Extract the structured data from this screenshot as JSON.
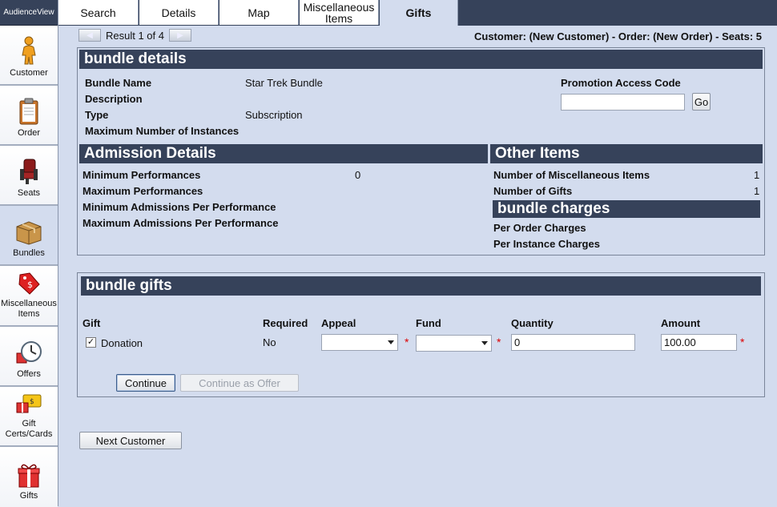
{
  "brand": "AudienceView",
  "nav": [
    {
      "label": "Customer",
      "icon": "customer-icon"
    },
    {
      "label": "Order",
      "icon": "clipboard-icon"
    },
    {
      "label": "Seats",
      "icon": "seat-icon"
    },
    {
      "label": "Bundles",
      "icon": "bundle-box-icon"
    },
    {
      "label": "Miscellaneous Items",
      "icon": "price-tag-icon"
    },
    {
      "label": "Offers",
      "icon": "clock-icon"
    },
    {
      "label": "Gift Certs/Cards",
      "icon": "gift-card-icon"
    },
    {
      "label": "Gifts",
      "icon": "gift-box-icon"
    }
  ],
  "tabs": [
    {
      "label": "Search"
    },
    {
      "label": "Details"
    },
    {
      "label": "Map"
    },
    {
      "label": "Miscellaneous Items"
    },
    {
      "label": "Gifts"
    }
  ],
  "pager": {
    "text": "Result 1 of 4",
    "prev": "previous-arrow-icon",
    "next": "next-arrow-icon"
  },
  "customer_info": "Customer: (New Customer) - Order: (New Order) - Seats: 5",
  "bundle_details": {
    "title": "bundle details",
    "name_label": "Bundle Name",
    "name_value": "Star Trek Bundle",
    "description_label": "Description",
    "type_label": "Type",
    "type_value": "Subscription",
    "max_instances_label": "Maximum Number of Instances",
    "promo_label": "Promotion Access Code",
    "promo_value": "",
    "go_label": "Go"
  },
  "admission": {
    "title": "Admission Details",
    "min_perf_label": "Minimum Performances",
    "min_perf_value": "0",
    "max_perf_label": "Maximum Performances",
    "min_adm_label": "Minimum Admissions Per Performance",
    "max_adm_label": "Maximum Admissions Per Performance"
  },
  "other_items": {
    "title": "Other Items",
    "misc_label": "Number of Miscellaneous Items",
    "misc_value": "1",
    "gifts_label": "Number of Gifts",
    "gifts_value": "1"
  },
  "charges": {
    "title": "bundle charges",
    "per_order_label": "Per Order Charges",
    "per_instance_label": "Per Instance Charges"
  },
  "gifts": {
    "title": "bundle gifts",
    "columns": {
      "gift": "Gift",
      "required": "Required",
      "appeal": "Appeal",
      "fund": "Fund",
      "quantity": "Quantity",
      "amount": "Amount"
    },
    "row": {
      "name": "Donation",
      "checked": "✓",
      "required": "No",
      "appeal": "",
      "fund": "",
      "quantity": "0",
      "amount": "100.00",
      "req_marker": "*"
    },
    "continue_label": "Continue",
    "continue_offer_label": "Continue as Offer"
  },
  "next_customer_label": "Next Customer",
  "colors": {
    "header": "#36425a",
    "page": "#d3dcee",
    "required": "#dd0000"
  }
}
